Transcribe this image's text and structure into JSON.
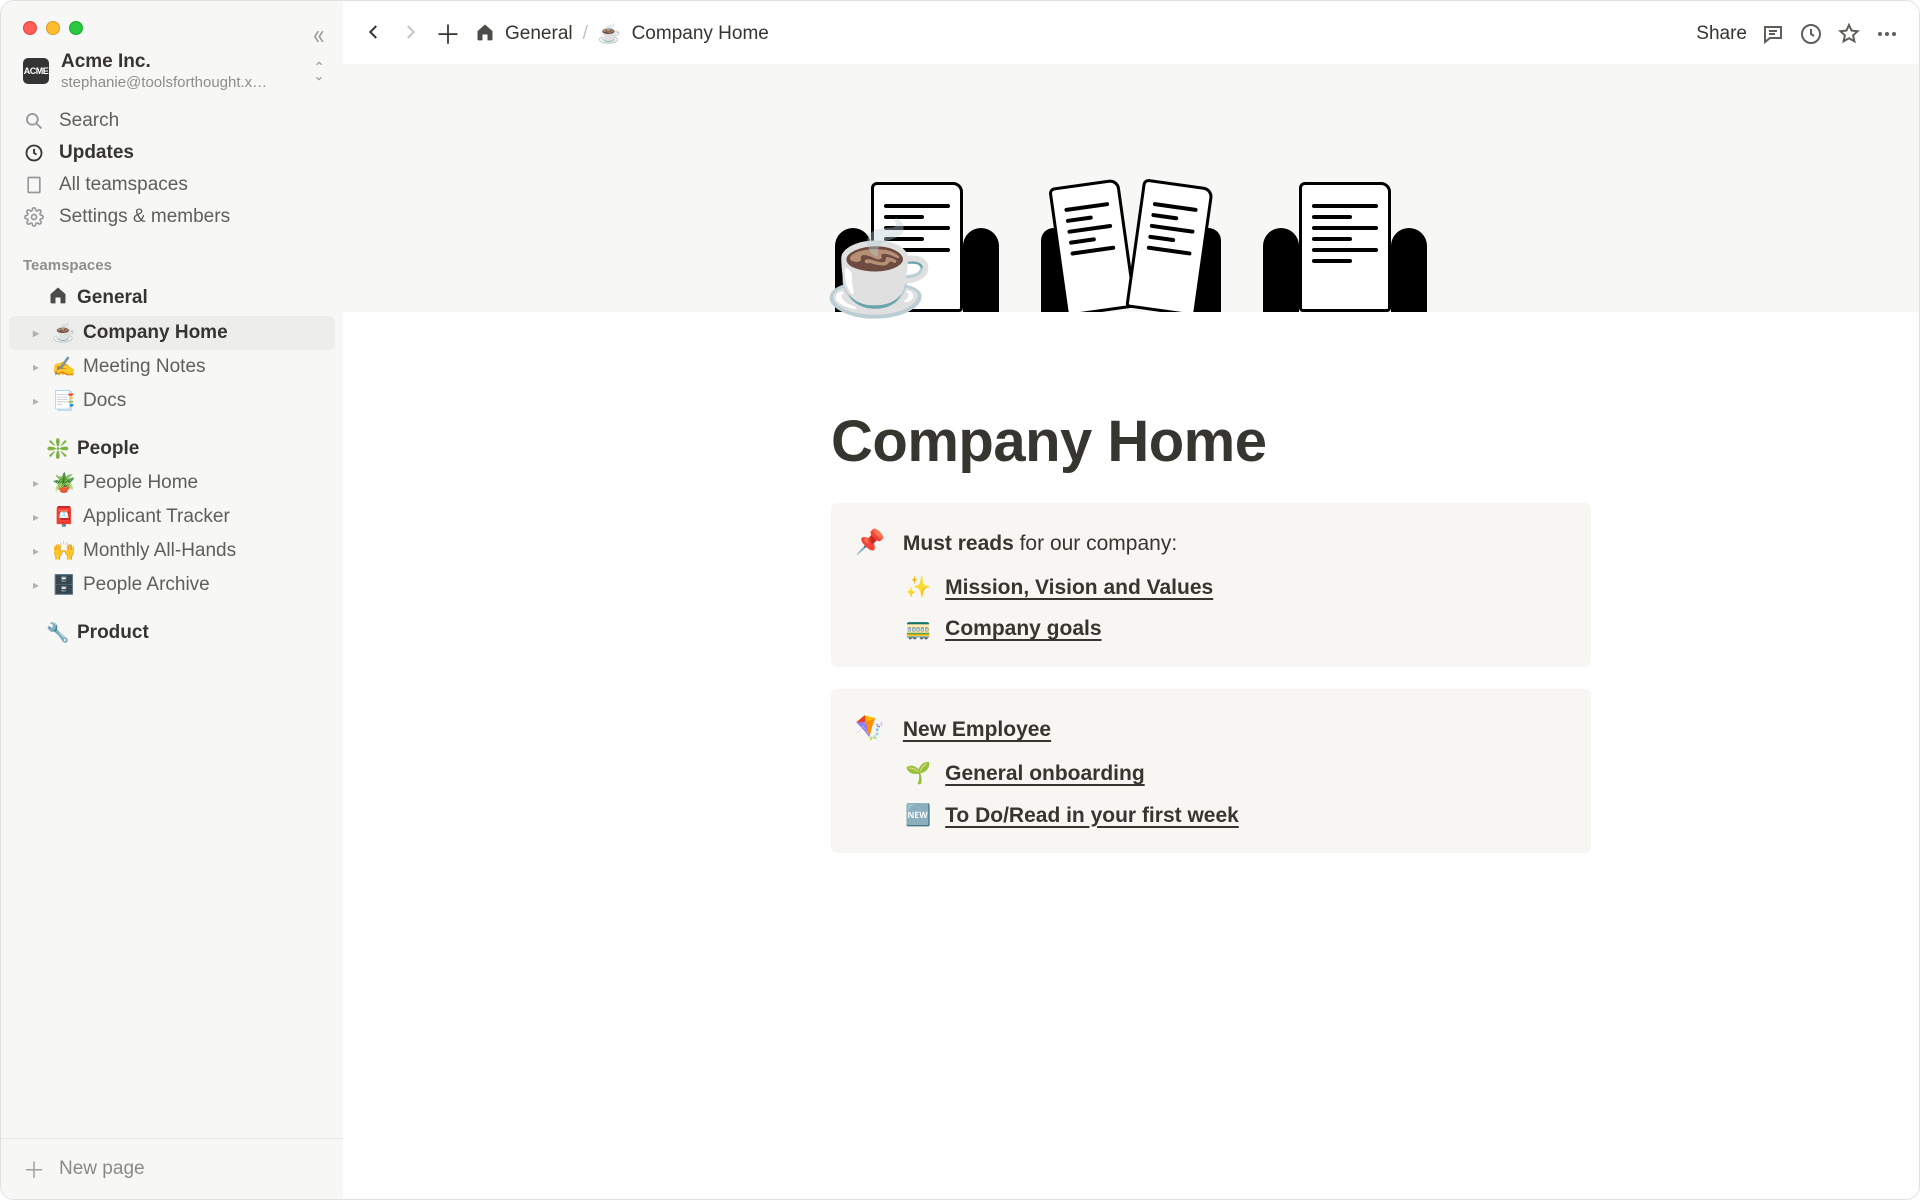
{
  "workspace": {
    "name": "Acme Inc.",
    "email": "stephanie@toolsforthought.x…",
    "icon_text": "ACME"
  },
  "nav": {
    "search": "Search",
    "updates": "Updates",
    "teamspaces": "All teamspaces",
    "settings": "Settings & members"
  },
  "sections": {
    "teamspaces_label": "Teamspaces"
  },
  "teamspaces": [
    {
      "icon": "house",
      "label": "General",
      "pages": [
        {
          "emoji": "☕",
          "label": "Company Home",
          "active": true
        },
        {
          "emoji": "✍️",
          "label": "Meeting Notes"
        },
        {
          "emoji": "📑",
          "label": "Docs"
        }
      ]
    },
    {
      "icon": "❇️",
      "label": "People",
      "pages": [
        {
          "emoji": "🪴",
          "label": "People Home"
        },
        {
          "emoji": "📮",
          "label": "Applicant Tracker"
        },
        {
          "emoji": "🙌",
          "label": "Monthly All-Hands"
        },
        {
          "emoji": "🗄️",
          "label": "People Archive"
        }
      ]
    },
    {
      "icon": "🔧",
      "label": "Product",
      "pages": []
    }
  ],
  "new_page": "New page",
  "breadcrumb": {
    "root_label": "General",
    "sep": "/",
    "page_emoji": "☕",
    "page_label": "Company Home"
  },
  "topbar": {
    "share": "Share"
  },
  "page": {
    "icon": "☕",
    "title": "Company Home"
  },
  "callouts": [
    {
      "emoji": "📌",
      "bold": "Must reads",
      "rest": " for our company:",
      "items": [
        {
          "emoji": "✨",
          "label": "Mission, Vision and Values"
        },
        {
          "emoji": "🚃",
          "label": "Company goals"
        }
      ]
    },
    {
      "emoji": "🪁",
      "head_link": "New Employee",
      "items": [
        {
          "emoji": "🌱",
          "label": "General onboarding"
        },
        {
          "emoji": "🆕",
          "label": "To Do/Read in your first week"
        }
      ]
    }
  ]
}
